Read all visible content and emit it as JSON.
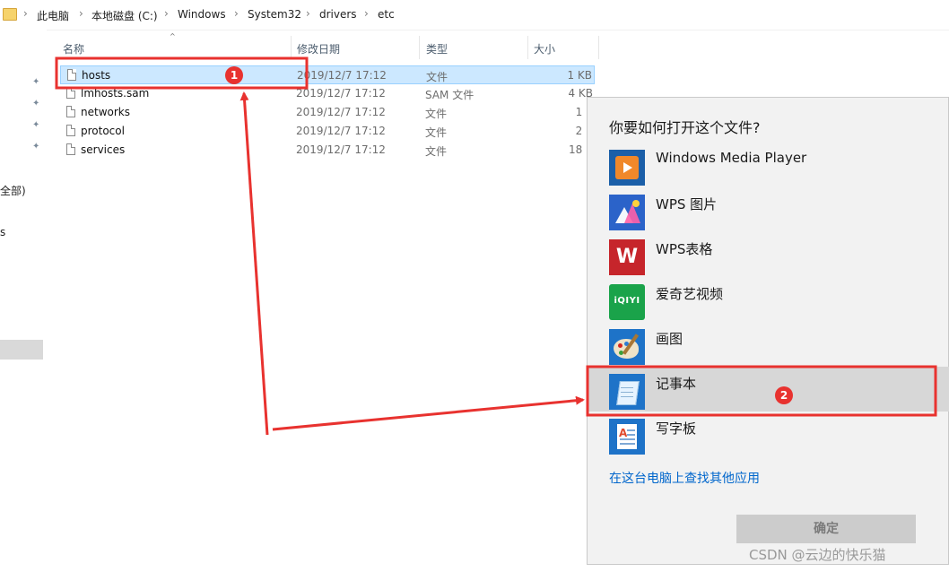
{
  "breadcrumb": {
    "items": [
      "此电脑",
      "本地磁盘 (C:)",
      "Windows",
      "System32",
      "drivers",
      "etc"
    ]
  },
  "nav": {
    "partial_labels": [
      "全部)",
      "s"
    ]
  },
  "columns": {
    "name": "名称",
    "date": "修改日期",
    "type": "类型",
    "size": "大小"
  },
  "files": [
    {
      "name": "hosts",
      "date": "2019/12/7 17:12",
      "type": "文件",
      "size": "1 KB",
      "selected": true
    },
    {
      "name": "lmhosts.sam",
      "date": "2019/12/7 17:12",
      "type": "SAM 文件",
      "size": "4 KB",
      "selected": false
    },
    {
      "name": "networks",
      "date": "2019/12/7 17:12",
      "type": "文件",
      "size": "1 K",
      "selected": false
    },
    {
      "name": "protocol",
      "date": "2019/12/7 17:12",
      "type": "文件",
      "size": "2 K",
      "selected": false
    },
    {
      "name": "services",
      "date": "2019/12/7 17:12",
      "type": "文件",
      "size": "18 K",
      "selected": false
    }
  ],
  "dialog": {
    "title": "你要如何打开这个文件?",
    "apps": [
      {
        "label": "Windows Media Player",
        "icon": "windows-media-player-icon"
      },
      {
        "label": "WPS 图片",
        "icon": "wps-picture-icon"
      },
      {
        "label": "WPS表格",
        "icon": "wps-spreadsheet-icon"
      },
      {
        "label": "爱奇艺视频",
        "icon": "iqiyi-icon",
        "icon_text": "iQIYI"
      },
      {
        "label": "画图",
        "icon": "paint-icon"
      },
      {
        "label": "记事本",
        "icon": "notepad-icon",
        "highlighted": true
      },
      {
        "label": "写字板",
        "icon": "wordpad-icon"
      }
    ],
    "more_apps_link": "在这台电脑上查找其他应用",
    "ok_button": "确定"
  },
  "annotations": {
    "badge_1": "1",
    "badge_2": "2",
    "color": "#e8322f"
  },
  "watermark": "CSDN @云边的快乐猫"
}
